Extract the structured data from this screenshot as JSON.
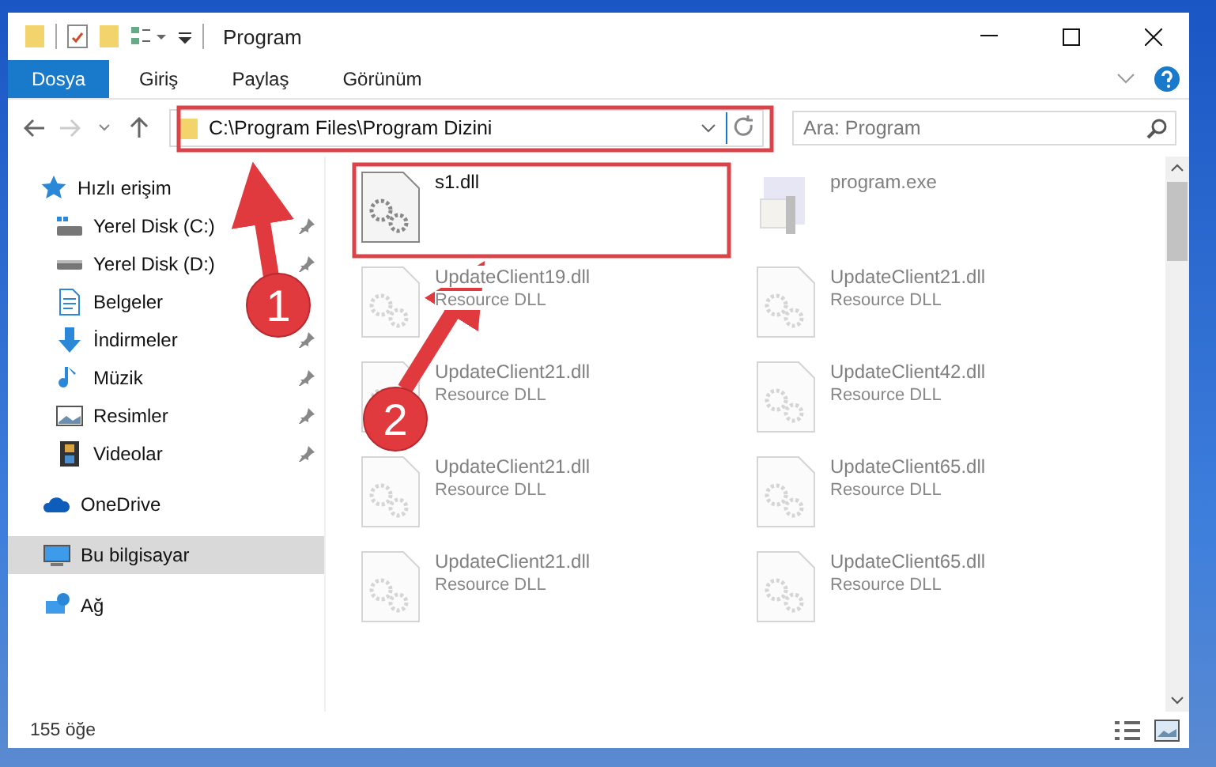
{
  "window": {
    "title": "Program"
  },
  "ribbon_tabs": [
    {
      "label": "Dosya",
      "selected": true
    },
    {
      "label": "Giriş",
      "selected": false
    },
    {
      "label": "Paylaş",
      "selected": false
    },
    {
      "label": "Görünüm",
      "selected": false
    }
  ],
  "address": {
    "value": "C:\\Program Files\\Program Dizini"
  },
  "search": {
    "placeholder": "Ara: Program"
  },
  "sidebar": {
    "items": [
      {
        "label": "Hızlı erişim",
        "kind": "star",
        "selected": false,
        "children": [
          {
            "label": "Yerel Disk (C:)",
            "kind": "drive-c",
            "pinned": true,
            "selected": false
          },
          {
            "label": "Yerel Disk (D:)",
            "kind": "drive",
            "pinned": true,
            "selected": false
          },
          {
            "label": "Belgeler",
            "kind": "document",
            "pinned": false,
            "selected": false
          },
          {
            "label": "İndirmeler",
            "kind": "download",
            "pinned": true,
            "selected": false
          },
          {
            "label": "Müzik",
            "kind": "music",
            "pinned": true,
            "selected": false
          },
          {
            "label": "Resimler",
            "kind": "image",
            "pinned": true,
            "selected": false
          },
          {
            "label": "Videolar",
            "kind": "video",
            "pinned": true,
            "selected": false
          }
        ]
      },
      {
        "label": "OneDrive",
        "kind": "cloud",
        "selected": false
      },
      {
        "label": "Bu bilgisayar",
        "kind": "computer",
        "selected": true
      },
      {
        "label": "Ağ",
        "kind": "network",
        "selected": false
      }
    ]
  },
  "files": [
    {
      "name": "s1.dll",
      "kind": "dll",
      "faded": false
    },
    {
      "name": "program.exe",
      "kind": "exe",
      "faded": true
    },
    {
      "name": "UpdateClient19.dll",
      "type": "Resource DLL",
      "kind": "dll",
      "faded": true
    },
    {
      "name": "UpdateClient21.dll",
      "type": "Resource DLL",
      "kind": "dll",
      "faded": true
    },
    {
      "name": "UpdateClient21.dll",
      "type": "Resource DLL",
      "kind": "dll",
      "faded": true
    },
    {
      "name": "UpdateClient42.dll",
      "type": "Resource DLL",
      "kind": "dll",
      "faded": true
    },
    {
      "name": "UpdateClient21.dll",
      "type": "Resource DLL",
      "kind": "dll",
      "faded": true
    },
    {
      "name": "UpdateClient65.dll",
      "type": "Resource DLL",
      "kind": "dll",
      "faded": true
    },
    {
      "name": "UpdateClient21.dll",
      "type": "Resource DLL",
      "kind": "dll",
      "faded": true
    },
    {
      "name": "UpdateClient65.dll",
      "type": "Resource DLL",
      "kind": "dll",
      "faded": true
    }
  ],
  "status_bar": {
    "item_count": "155 öğe"
  },
  "annotations": [
    {
      "label": "1"
    },
    {
      "label": "2"
    }
  ]
}
